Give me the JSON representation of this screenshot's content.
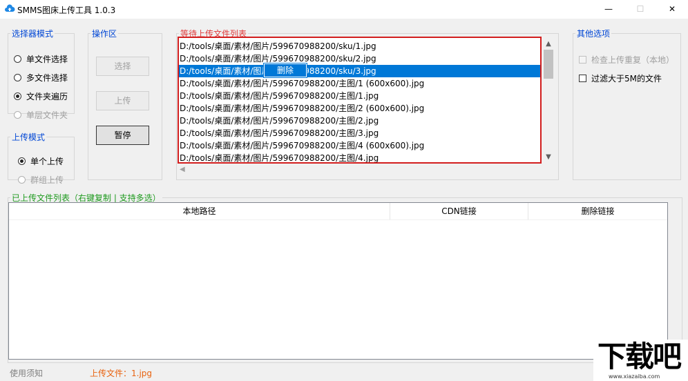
{
  "window": {
    "title": "SMMS图床上传工具 1.0.3",
    "minimize_glyph": "—",
    "maximize_glyph": "☐",
    "close_glyph": "✕",
    "app_icon": "cloud-upload-icon"
  },
  "selector_mode": {
    "legend": "选择器模式",
    "options": [
      {
        "label": "单文件选择",
        "selected": false,
        "disabled": false
      },
      {
        "label": "多文件选择",
        "selected": false,
        "disabled": false
      },
      {
        "label": "文件夹遍历",
        "selected": true,
        "disabled": false
      },
      {
        "label": "单层文件夹",
        "selected": false,
        "disabled": true
      }
    ]
  },
  "upload_mode": {
    "legend": "上传模式",
    "options": [
      {
        "label": "单个上传",
        "selected": true,
        "disabled": false
      },
      {
        "label": "群组上传",
        "selected": false,
        "disabled": true
      }
    ]
  },
  "operations": {
    "legend": "操作区",
    "select_label": "选择",
    "upload_label": "上传",
    "pause_label": "暂停"
  },
  "pending_list": {
    "legend": "等待上传文件列表",
    "items": [
      "D:/tools/桌面/素材/图片/599670988200/sku/1.jpg",
      "D:/tools/桌面/素材/图片/599670988200/sku/2.jpg",
      "D:/tools/桌面/素材/图片/599670988200/sku/3.jpg",
      "D:/tools/桌面/素材/图片/599670988200/主图/1 (600x600).jpg",
      "D:/tools/桌面/素材/图片/599670988200/主图/1.jpg",
      "D:/tools/桌面/素材/图片/599670988200/主图/2 (600x600).jpg",
      "D:/tools/桌面/素材/图片/599670988200/主图/2.jpg",
      "D:/tools/桌面/素材/图片/599670988200/主图/3.jpg",
      "D:/tools/桌面/素材/图片/599670988200/主图/4 (600x600).jpg",
      "D:/tools/桌面/素材/图片/599670988200/主图/4.jpg"
    ],
    "selected_index": 2,
    "context_menu": {
      "delete_label": "删除"
    }
  },
  "other_options": {
    "legend": "其他选项",
    "check_duplicate_label": "检查上传重复（本地）",
    "filter_large_label": "过滤大于5M的文件"
  },
  "uploaded_list": {
    "legend": "已上传文件列表（右键复制 | 支持多选）",
    "columns": [
      "本地路径",
      "CDN链接",
      "删除链接"
    ]
  },
  "status": {
    "help_label": "使用须知",
    "uploaded_text": "上传文件：1.jpg"
  },
  "watermark": {
    "big_text": "下载吧",
    "small_text": "www.xiazaiba.com"
  },
  "colors": {
    "accent_blue": "#0078d7",
    "highlight_red": "#d21d1d",
    "legend_blue": "#0046d5",
    "legend_green": "#1e9a1e"
  }
}
